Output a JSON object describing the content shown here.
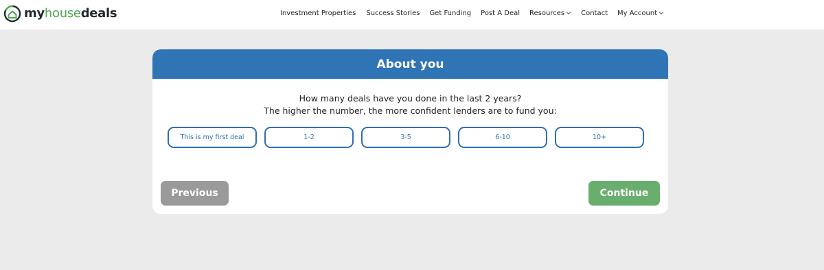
{
  "brand": {
    "logo_my": "my",
    "logo_house": "house",
    "logo_deals": "deals",
    "logo_icon": "house-circle-logo-icon"
  },
  "nav": {
    "items": [
      {
        "label": "Investment Properties",
        "has_dropdown": false
      },
      {
        "label": "Success Stories",
        "has_dropdown": false
      },
      {
        "label": "Get Funding",
        "has_dropdown": false
      },
      {
        "label": "Post A Deal",
        "has_dropdown": false
      },
      {
        "label": "Resources",
        "has_dropdown": true
      },
      {
        "label": "Contact",
        "has_dropdown": false
      },
      {
        "label": "My Account",
        "has_dropdown": true
      }
    ]
  },
  "card": {
    "title": "About you",
    "question_line1": "How many deals have you done in the last 2 years?",
    "question_line2": "The higher the number, the more confident lenders are to fund you:",
    "options": [
      "This is my first deal",
      "1-2",
      "3-5",
      "6-10",
      "10+"
    ],
    "previous_label": "Previous",
    "continue_label": "Continue"
  },
  "colors": {
    "header_blue": "#2f74b5",
    "option_border": "#2f6fb0",
    "previous_bg": "#9a9a9a",
    "continue_bg": "#6aae6e",
    "page_bg": "#ebebeb",
    "brand_green": "#4aa84a"
  }
}
